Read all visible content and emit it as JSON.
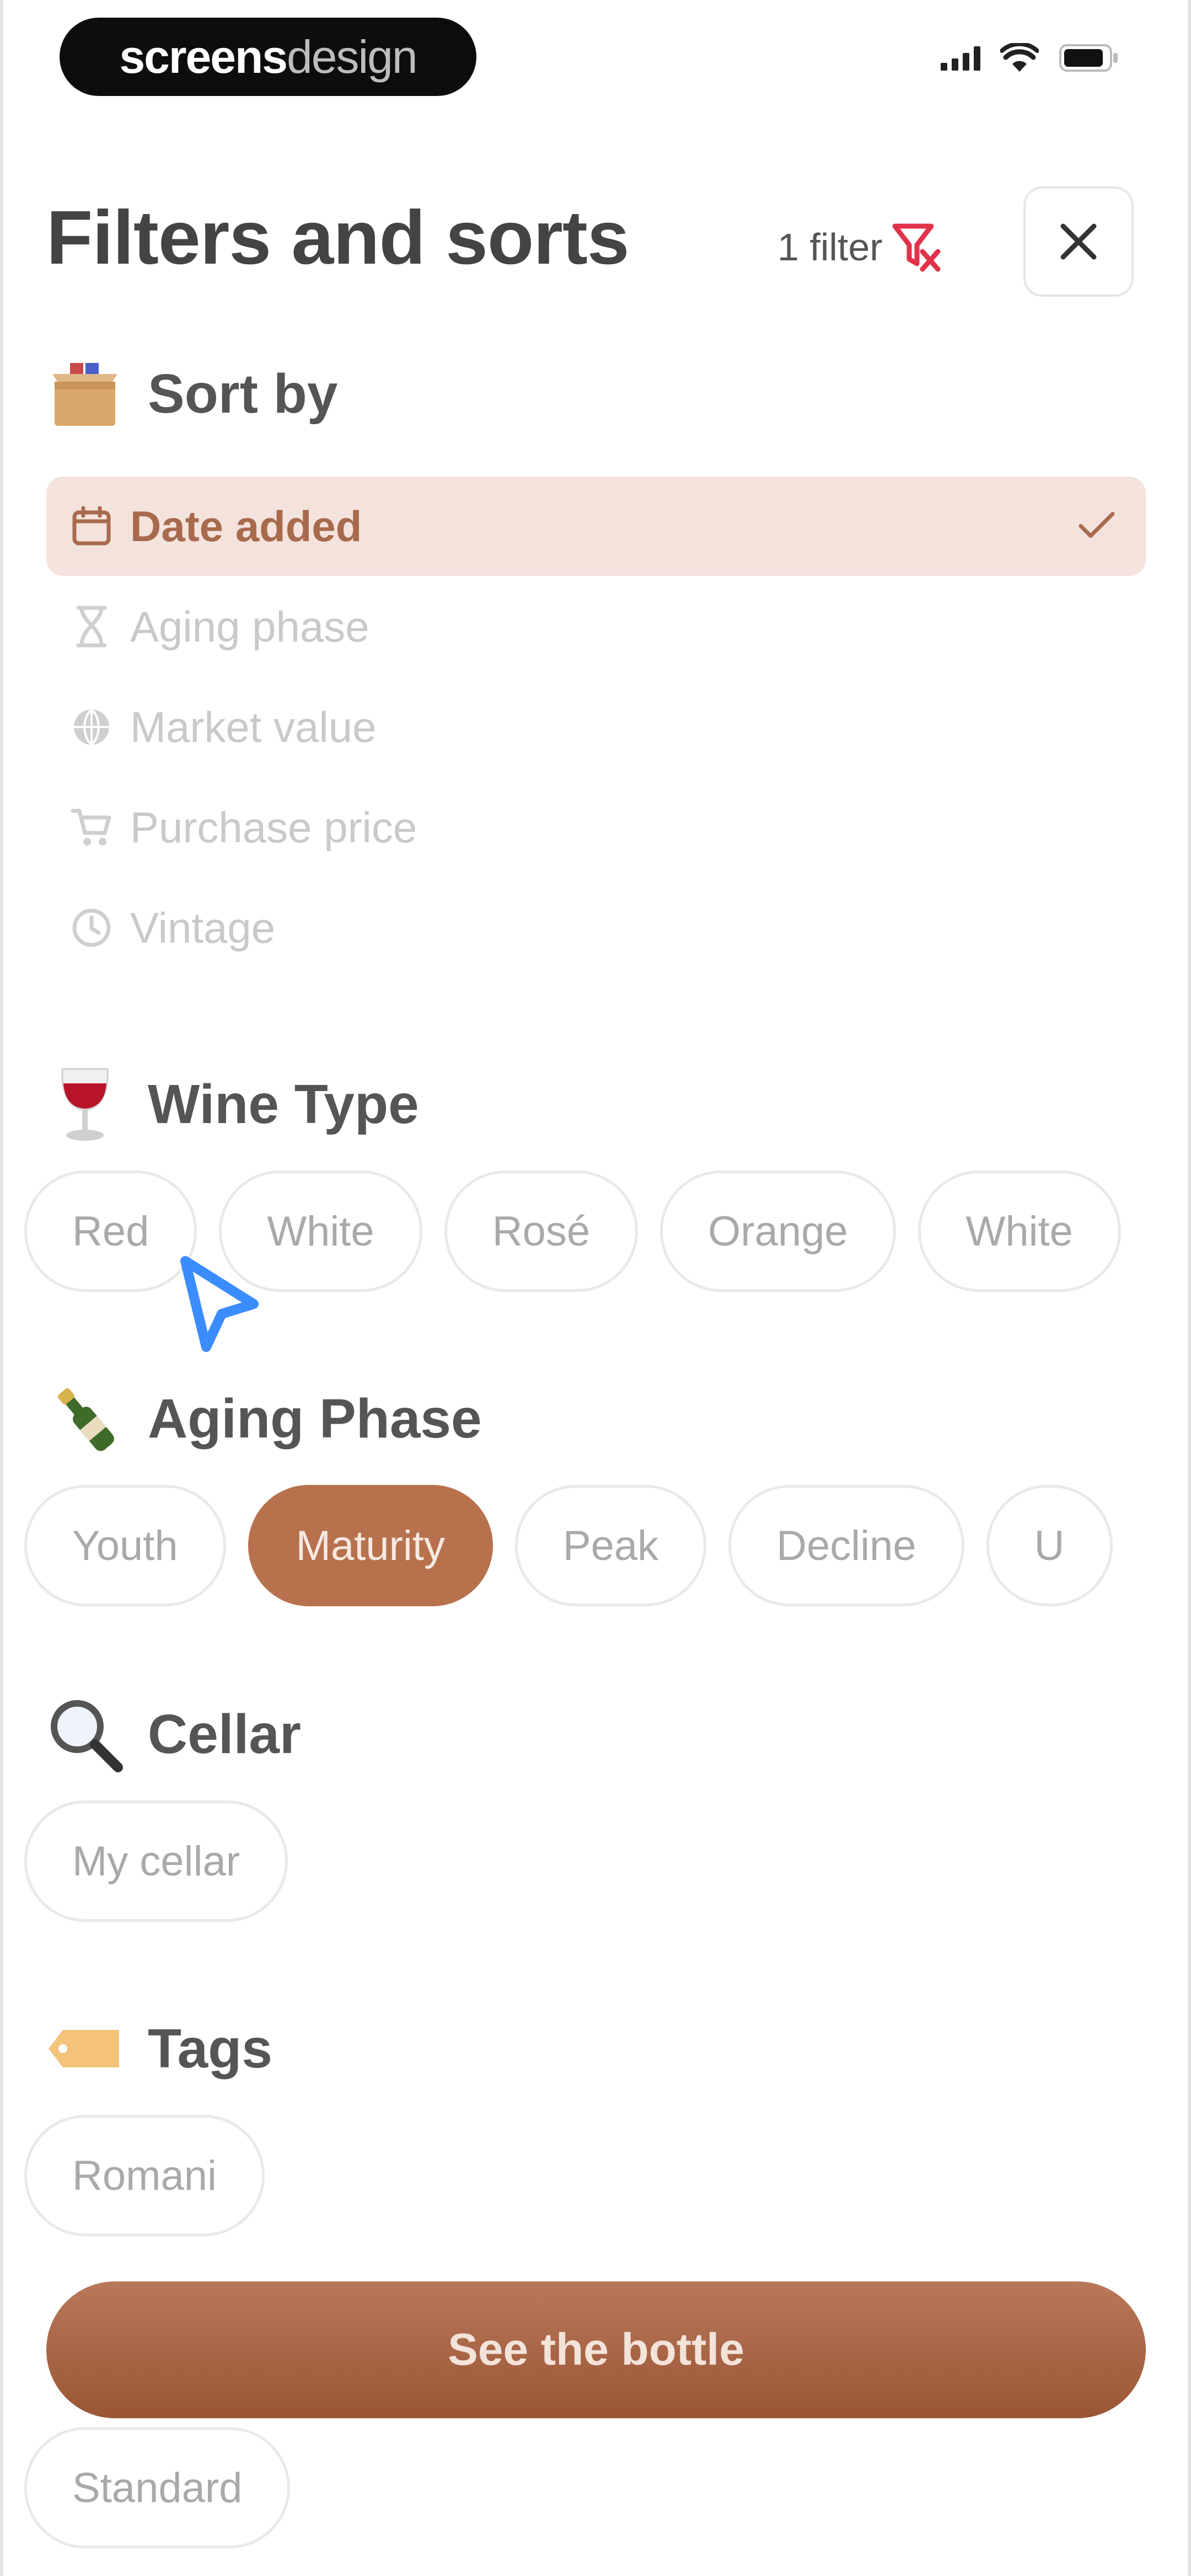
{
  "brand": {
    "part1": "screens",
    "part2": "design"
  },
  "header": {
    "title": "Filters and sorts",
    "filter_count": "1 filter"
  },
  "sort": {
    "title": "Sort by",
    "options": [
      {
        "label": "Date added",
        "icon": "calendar-icon",
        "selected": true
      },
      {
        "label": "Aging phase",
        "icon": "hourglass-icon",
        "selected": false
      },
      {
        "label": "Market value",
        "icon": "globe-icon",
        "selected": false
      },
      {
        "label": "Purchase price",
        "icon": "cart-icon",
        "selected": false
      },
      {
        "label": "Vintage",
        "icon": "clock-icon",
        "selected": false
      }
    ]
  },
  "wine_type": {
    "title": "Wine Type",
    "chips": [
      "Red",
      "White",
      "Rosé",
      "Orange",
      "White"
    ]
  },
  "aging_phase": {
    "title": "Aging Phase",
    "chips": [
      "Youth",
      "Maturity",
      "Peak",
      "Decline",
      "U"
    ],
    "active": "Maturity"
  },
  "cellar": {
    "title": "Cellar",
    "chips": [
      "My cellar"
    ]
  },
  "tags": {
    "title": "Tags",
    "chips": [
      "Romani"
    ]
  },
  "cta": {
    "label": "See the bottle"
  },
  "extra_chip": {
    "label": "Standard"
  },
  "colors": {
    "accent": "#b7724d",
    "selected_bg": "#f4e3dd",
    "filter_red": "#e0334a",
    "cursor_blue": "#3b8cff"
  }
}
